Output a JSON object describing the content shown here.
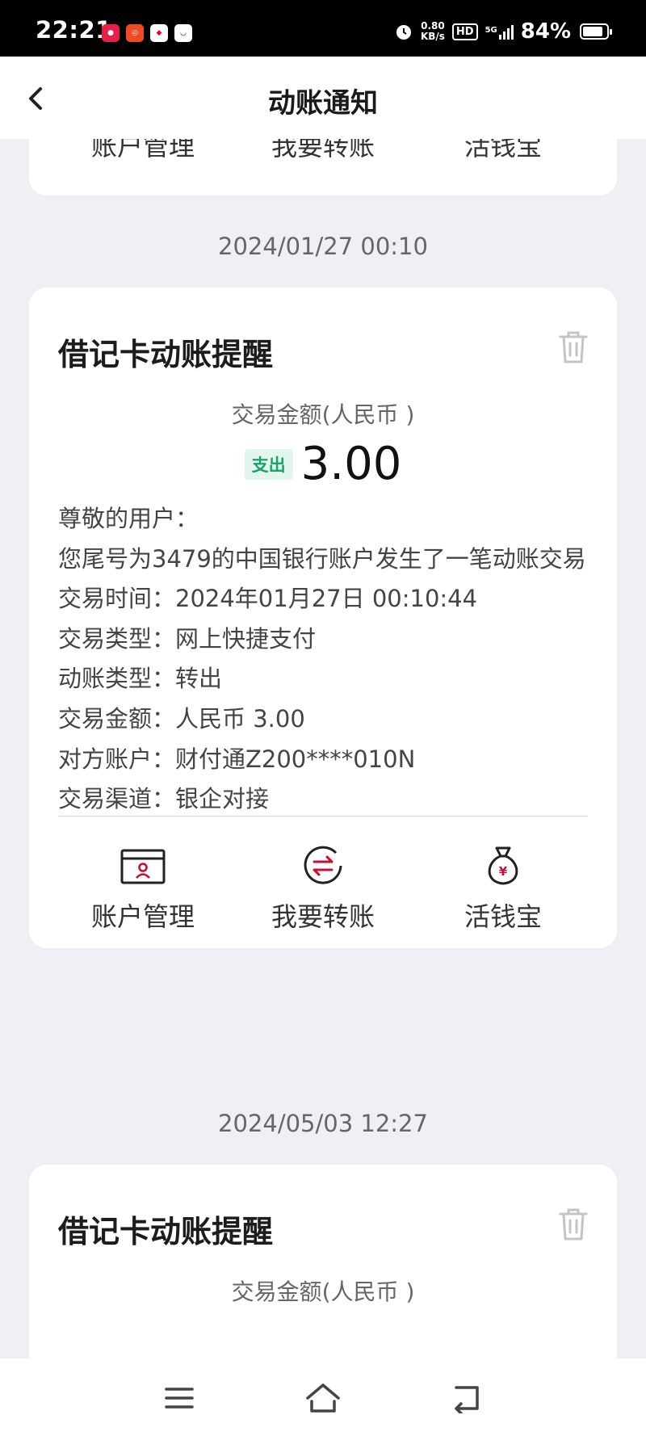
{
  "status_bar": {
    "time": "22:21",
    "app_icons": [
      "app-icon-red",
      "app-icon-orange",
      "app-icon-map",
      "app-icon-mail"
    ],
    "net_speed_value": "0.80",
    "net_speed_unit": "KB/s",
    "hd": "HD",
    "network": "5G",
    "battery": "84%",
    "battery_level": 0.84
  },
  "header": {
    "title": "动账通知",
    "back_icon": "chevron-left-icon"
  },
  "top_card_actions": [
    {
      "label": "账户管理"
    },
    {
      "label": "我要转账"
    },
    {
      "label": "活钱宝"
    }
  ],
  "notifications": [
    {
      "date": "2024/01/27 00:10",
      "title": "借记卡动账提醒",
      "amount_label": "交易金额(人民币 )",
      "badge": "支出",
      "amount": "3.00",
      "lines": [
        "尊敬的用户：",
        "您尾号为3479的中国银行账户发生了一笔动账交易",
        "交易时间：2024年01月27日 00:10:44",
        "交易类型：网上快捷支付",
        "动账类型：转出",
        "交易金额：人民币 3.00",
        "对方账户：财付通Z200****010N",
        "交易渠道：银企对接"
      ],
      "actions": [
        {
          "label": "账户管理",
          "icon": "account-card-icon"
        },
        {
          "label": "我要转账",
          "icon": "transfer-icon"
        },
        {
          "label": "活钱宝",
          "icon": "money-bag-icon"
        }
      ]
    },
    {
      "date": "2024/05/03 12:27",
      "title": "借记卡动账提醒",
      "amount_label": "交易金额(人民币 )"
    }
  ],
  "nav_bar": {
    "menu_icon": "menu-icon",
    "home_icon": "home-icon",
    "back_icon": "back-icon"
  },
  "colors": {
    "page_bg": "#efeff4",
    "badge_bg": "#e2f6ef",
    "badge_text": "#18a36b",
    "accent_red": "#c8102e"
  }
}
